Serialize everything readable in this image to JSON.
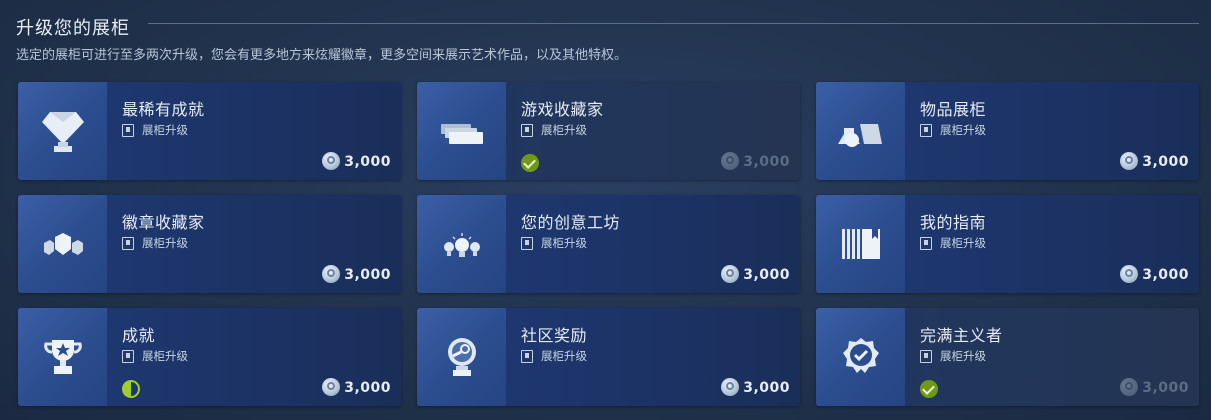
{
  "header": {
    "title": "升级您的展柜",
    "subtitle": "选定的展柜可进行至多两次升级，您会有更多地方来炫耀徽章，更多空间来展示艺术作品，以及其他特权。"
  },
  "tag_label": "展柜升级",
  "colors": {
    "accent_blue": "#2b4d8e",
    "owned_green": "#6f9a18",
    "partial_green": "#9fd02a"
  },
  "cards": [
    {
      "name": "最稀有成就",
      "icon": "diamond-icon",
      "price": "3,000",
      "status": "none",
      "faded": false
    },
    {
      "name": "游戏收藏家",
      "icon": "game-cards-icon",
      "price": "3,000",
      "status": "owned",
      "faded": true
    },
    {
      "name": "物品展柜",
      "icon": "items-icon",
      "price": "3,000",
      "status": "none",
      "faded": false
    },
    {
      "name": "徽章收藏家",
      "icon": "badges-icon",
      "price": "3,000",
      "status": "none",
      "faded": false
    },
    {
      "name": "您的创意工坊",
      "icon": "lightbulbs-icon",
      "price": "3,000",
      "status": "none",
      "faded": false
    },
    {
      "name": "我的指南",
      "icon": "guide-icon",
      "price": "3,000",
      "status": "none",
      "faded": false
    },
    {
      "name": "成就",
      "icon": "trophy-icon",
      "price": "3,000",
      "status": "partial",
      "faded": false
    },
    {
      "name": "社区奖励",
      "icon": "steam-award-icon",
      "price": "3,000",
      "status": "none",
      "faded": false
    },
    {
      "name": "完满主义者",
      "icon": "badge-seal-icon",
      "price": "3,000",
      "status": "owned",
      "faded": true
    }
  ]
}
